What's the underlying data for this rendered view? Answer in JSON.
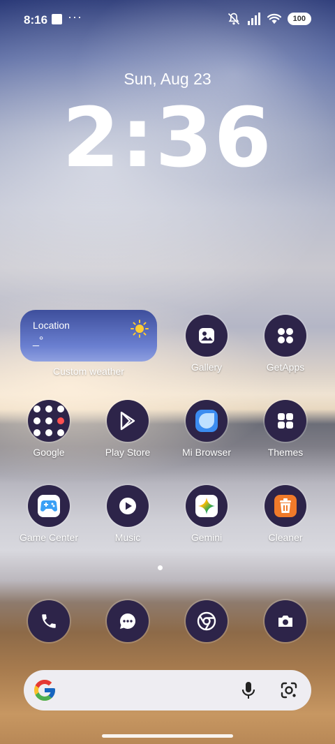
{
  "status_bar": {
    "time": "8:16",
    "dots": "···",
    "battery": "100"
  },
  "lock": {
    "date": "Sun, Aug 23",
    "time": "2:36"
  },
  "weather_widget": {
    "location": "Location",
    "value": "_°",
    "label": "Custom weather"
  },
  "apps": {
    "gallery": "Gallery",
    "getapps": "GetApps",
    "google": "Google",
    "playstore": "Play Store",
    "mibrowser": "Mi Browser",
    "themes": "Themes",
    "gamecenter": "Game Center",
    "music": "Music",
    "gemini": "Gemini",
    "cleaner": "Cleaner"
  },
  "dock": [
    "phone",
    "messages",
    "chrome",
    "camera"
  ],
  "colors": {
    "icon_bg": "#2d2449",
    "search_bg": "#eeedf2"
  }
}
